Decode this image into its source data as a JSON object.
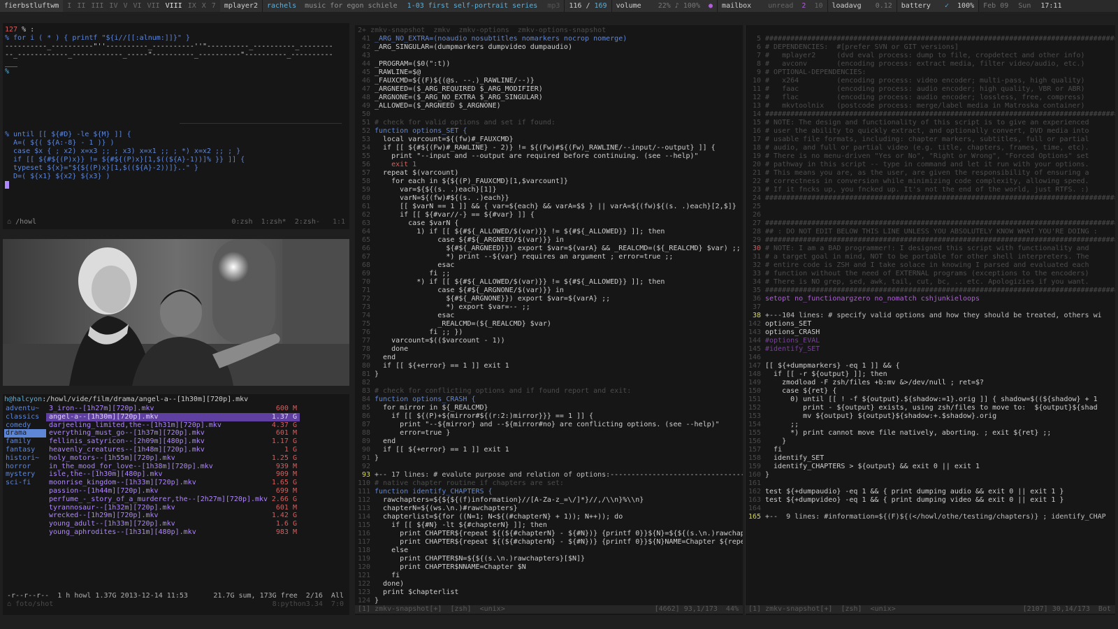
{
  "topbar": {
    "wm_name": "fierbstluftwm",
    "tags": [
      "I",
      "II",
      "III",
      "IV",
      "V",
      "VI",
      "VII",
      "VIII",
      "IX",
      "X"
    ],
    "tag_extra": "7",
    "player": "mplayer2",
    "artist": "rachels",
    "album": "music for egon schiele",
    "track": "1-03 first self-portrait series",
    "format": "mp3",
    "pos": "116",
    "total": "169",
    "volume_label": "volume",
    "volume_value": "22%",
    "volume_max": "100%",
    "mailbox_label": "mailbox",
    "unread_label": "unread",
    "unread": "2",
    "mail_total": "10",
    "loadavg_label": "loadavg",
    "loadavg": "0.12",
    "battery_label": "battery",
    "battery_check": "✓",
    "battery": "100%",
    "date": "Feb 09",
    "day": "Sun",
    "time": "17:11"
  },
  "term1": {
    "prompt_num": "127",
    "line1": "% for i ( * ) { printf \"${i//[[:alnum:]]}\" }",
    "output1": "----------_----------\"''----------_----------''\"----------_----------_--------",
    "output2": "--_------------_------------_-----\"----------_----------\"----------_----------",
    "output3": "___ ",
    "prompt2": "%",
    "code": [
      "% until [[ ${#D} -le ${M} ]] {",
      "  A=( ${( ${A:-8} - 1 )} )",
      "  case $x { ; x2) x=x3 ;; ; x3) x=x1 ;; ; *) x=x2 ;; ; }",
      "  if [[ ${#${(P)x}} != ${#${(P)x}[1,$((${A}-1))]% }} ]] {",
      "  typeset ${x}=\"${${(P)x}[1,$((${A}-2))]}..\" }",
      "  D=( ${x1} ${x2} ${x3} )"
    ],
    "path": "/howl",
    "tabs": "0:zsh  1:zsh*  2:zsh-",
    "pos": "1:1"
  },
  "filemanager": {
    "path_host": "h@halcyon",
    "path": ":/howl/vide/film/drama/angel-a--[1h30m][720p].mkv",
    "categories": [
      "adventu~",
      "classics",
      "comedy",
      "drama",
      "family",
      "fantasy",
      "histori~",
      "horror",
      "mystery",
      "sci-fi"
    ],
    "selected_category": 3,
    "files": [
      {
        "name": "3_iron--[1h27m][720p].mkv",
        "size": "600 M"
      },
      {
        "name": "angel-a--[1h30m][720p].mkv",
        "size": "1.37 G"
      },
      {
        "name": "darjeeling_limited,the--[1h31m][720p].mkv",
        "size": "4.37 G"
      },
      {
        "name": "everything_must_go--[1h37m][720p].mkv",
        "size": "601 M"
      },
      {
        "name": "fellinis_satyricon--[2h09m][480p].mkv",
        "size": "1.17 G"
      },
      {
        "name": "heavenly_creatures--[1h48m][720p].mkv",
        "size": "1 G"
      },
      {
        "name": "holy_motors--[1h55m][720p].mkv",
        "size": "1.25 G"
      },
      {
        "name": "in_the_mood_for_love--[1h38m][720p].mkv",
        "size": "939 M"
      },
      {
        "name": "isle,the--[1h30m][480p].mkv",
        "size": "909 M"
      },
      {
        "name": "moonrise_kingdom--[1h33m][720p].mkv",
        "size": "1.65 G"
      },
      {
        "name": "passion--[1h44m][720p].mkv",
        "size": "699 M"
      },
      {
        "name": "perfume_-_story_of_a_murderer,the--[2h27m][720p].mkv",
        "size": "2.66 G"
      },
      {
        "name": "tyrannosaur--[1h32m][720p].mkv",
        "size": "601 M"
      },
      {
        "name": "wrecked--[1h29m][720p].mkv",
        "size": "1.42 G"
      },
      {
        "name": "young_adult--[1h33m][720p].mkv",
        "size": "1.6 G"
      },
      {
        "name": "young_aphrodites--[1h31m][480p].mkv",
        "size": "983 M"
      }
    ],
    "selected_file": 1,
    "status_left": "-r--r--r--  1 h howl 1.37G 2013-12-14 11:53",
    "status_right": "21.7G sum, 173G free  2/16  All",
    "footer_path": "foto/shot",
    "footer_right": "8:python3.34  7:0"
  },
  "editor_left": {
    "tabline": "2+ zmkv-snapshot  zmkv  zmkv-options  zmkv-options-snapshot",
    "lines": [
      [
        "41",
        "_ARG_NO_EXTRA=(noaudio nosubtitles nomarkers nocrop nomerge)",
        "kw"
      ],
      [
        "42",
        "_ARG_SINGULAR=(dumpmarkers dumpvideo dumpaudio)",
        "wh"
      ],
      [
        "43",
        "",
        ""
      ],
      [
        "44",
        "_PROGRAM=($0(\":t))",
        "wh"
      ],
      [
        "45",
        "_RAWLINE=$@",
        "wh"
      ],
      [
        "46",
        "_FAUXCMD=${(F)${(@s. --.)_RAWLINE/--)}",
        "wh"
      ],
      [
        "47",
        "_ARGNEED=($_ARG_REQUIRED $_ARG_MODIFIER)",
        "wh"
      ],
      [
        "48",
        "_ARGNONE=($_ARG_NO_EXTRA $_ARG_SINGULAR)",
        "wh"
      ],
      [
        "49",
        "_ALLOWED=($_ARGNEED $_ARGNONE)",
        "wh"
      ],
      [
        "50",
        "",
        ""
      ],
      [
        "51",
        "# check for valid options and set if found:",
        "cm"
      ],
      [
        "52",
        "function options_SET {",
        "kw"
      ],
      [
        "53",
        "  local varcount=${(fw)#_FAUXCMD}",
        "wh"
      ],
      [
        "54",
        "  if [[ ${#${(Fw)#_RAWLINE} - 2)} != ${(Fw)#${(Fw)_RAWLINE/--input/--output} ]] {",
        "wh"
      ],
      [
        "55",
        "    print \"--input and --output are required before continuing. (see --help)\"",
        "wh"
      ],
      [
        "56",
        "    exit 1",
        "red"
      ],
      [
        "57",
        "  repeat $(varcount)",
        "wh"
      ],
      [
        "58",
        "    for each in ${${(P)_FAUXCMD}[1,$varcount]}",
        "wh"
      ],
      [
        "59",
        "      var=${${(s. .)each}[1]}",
        "wh"
      ],
      [
        "60",
        "      varN=${(fw)#${(s. .)each}}",
        "wh"
      ],
      [
        "61",
        "      [[ $varN == 1 ]] && { var=${each} && varA=$$ } || varA=${(fw)${(s. .)each}[2,$]}",
        "wh"
      ],
      [
        "62",
        "      if [[ ${#var//-} == ${#var} ]] {",
        "wh"
      ],
      [
        "63",
        "        case $varN {",
        "wh"
      ],
      [
        "64",
        "          1) if [[ ${#${_ALLOWED/$(var)}} != ${#${_ALLOWED}} ]]; then",
        "wh"
      ],
      [
        "65",
        "               case ${#${_ARGNEED/$(var)}} in",
        "wh"
      ],
      [
        "66",
        "                 ${#${_ARGNEED}}) export $var=${varA} && _REALCMD=(${_REALCMD} $var) ;;",
        "wh"
      ],
      [
        "67",
        "                 *) print --${var} requires an argument ; error=true ;;",
        "wh"
      ],
      [
        "68",
        "               esac",
        "wh"
      ],
      [
        "69",
        "             fi ;;",
        "wh"
      ],
      [
        "70",
        "          *) if [[ ${#${_ALLOWED/$(var)}} != ${#${_ALLOWED}} ]]; then",
        "wh"
      ],
      [
        "71",
        "               case ${#${_ARGNONE/$(var)}} in",
        "wh"
      ],
      [
        "72",
        "                 ${#${_ARGNONE}}) export $var=${varA} ;;",
        "wh"
      ],
      [
        "73",
        "                 *) export $var=-- ;;",
        "wh"
      ],
      [
        "74",
        "               esac",
        "wh"
      ],
      [
        "75",
        "               _REALCMD=(${_REALCMD} $var)",
        "wh"
      ],
      [
        "76",
        "             fi ;; })",
        "wh"
      ],
      [
        "77",
        "    varcount=$(($varcount - 1))",
        "wh"
      ],
      [
        "78",
        "    done",
        "wh"
      ],
      [
        "79",
        "  end",
        "wh"
      ],
      [
        "80",
        "  if [[ ${+error} == 1 ]] exit 1",
        "wh"
      ],
      [
        "81",
        "}",
        "wh"
      ],
      [
        "82",
        "",
        ""
      ],
      [
        "83",
        "# check for conflicting options and if found report and exit:",
        "cm"
      ],
      [
        "84",
        "function options_CRASH {",
        "kw"
      ],
      [
        "85",
        "  for mirror in ${_REALCMD}",
        "wh"
      ],
      [
        "86",
        "    if [[ ${(P)+${mirror#${(r:2:)mirror}}} == 1 ]] {",
        "wh"
      ],
      [
        "87",
        "      print \"--${mirror} and --${mirror#no} are conflicting options. (see --help)\"",
        "wh"
      ],
      [
        "88",
        "      error=true }",
        "wh"
      ],
      [
        "89",
        "  end",
        "wh"
      ],
      [
        "90",
        "  if [[ ${+error} == 1 ]] exit 1",
        "wh"
      ],
      [
        "91",
        "}",
        "wh"
      ],
      [
        "92",
        "",
        ""
      ],
      [
        "93",
        "+-- 17 lines: # evalute purpose and relation of options:---------------------------------------",
        "fold"
      ],
      [
        "110",
        "# native chapter routine if chapters are set:",
        "cm"
      ],
      [
        "111",
        "function identify_CHAPTERS {",
        "kw"
      ],
      [
        "112",
        "  rawchapters=${${${(f)information}//[A-Za-z_=\\/]*}//,/\\\\n}%\\\\n}",
        "wh"
      ],
      [
        "113",
        "  chapterN=${(ws.\\n.)#rawchapters}",
        "wh"
      ],
      [
        "114",
        "  chapterlist=${for ((N=1; N<${(#chapterN} + 1)); N++)); do",
        "wh"
      ],
      [
        "115",
        "    if [[ ${#N} -lt ${#chapterN} ]]; then",
        "wh"
      ],
      [
        "116",
        "      print CHAPTER${repeat ${(${#chapterN} - ${#N})} {printf 0}}${N}=${${(s.\\n.)rawchapter",
        "wh"
      ],
      [
        "117",
        "      print CHAPTER${repeat ${(${#chapterN} - ${#N})} {printf 0}}${N}NAME=Chapter ${repeat",
        "wh"
      ],
      [
        "118",
        "    else",
        "wh"
      ],
      [
        "119",
        "      print CHAPTER$N=${${(s.\\n.)rawchapters}[$N]}",
        "wh"
      ],
      [
        "120",
        "      print CHAPTER$NNAME=Chapter $N",
        "wh"
      ],
      [
        "121",
        "    fi",
        "wh"
      ],
      [
        "122",
        "  done)",
        "wh"
      ],
      [
        "123",
        "  print $chapterlist",
        "wh"
      ],
      [
        "124",
        "}",
        "wh"
      ]
    ],
    "status_left": "[1] zmkv-snapshot[+]  [zsh]  <unix>",
    "status_right": "[4662] 93,1/173  44%"
  },
  "editor_right": {
    "lines": [
      [
        "5",
        "#############################################################################################",
        "cm"
      ],
      [
        "6",
        "# DEPENDENCIES:  #[prefer SVN or GIT versions]                                                 #",
        "cm"
      ],
      [
        "7",
        "#   mplayer2     (dvd eval process: dump to file, cropdetect and other info)                   #",
        "cm"
      ],
      [
        "8",
        "#   avconv       (encoding process: extract media, filter video/audio, etc.)                   #",
        "cm"
      ],
      [
        "9",
        "# OPTIONAL-DEPENDENCIES:                                                                        #",
        "cm"
      ],
      [
        "10",
        "#   x264         (encoding process: video encoder; multi-pass, high quality)                   #",
        "cm"
      ],
      [
        "11",
        "#   faac         (encoding process: audio encoder; high quality, VBR or ABR)                   #",
        "cm"
      ],
      [
        "12",
        "#   flac         (encoding process: audio encoder; lossless, free, compress)                   #",
        "cm"
      ],
      [
        "13",
        "#   mkvtoolnix   (postcode process: merge/label media in Matroska container)                   #",
        "cm"
      ],
      [
        "14",
        "#############################################################################################",
        "cm"
      ],
      [
        "15",
        "# NOTE: The design and functionality of this script is to give an experienced                #",
        "cm"
      ],
      [
        "16",
        "# user the ability to quickly extract, and optionally convert, DVD media into                  #",
        "cm"
      ],
      [
        "17",
        "# usable file formats, including: chapter markers, subtitles, full or partial                 #",
        "cm"
      ],
      [
        "18",
        "# audio, and full or partial video (e.g. title, chapters, frames, time, etc).                 #",
        "cm"
      ],
      [
        "19",
        "# There is no menu-driven \"Yes or No\", \"Right or Wrong\", \"Forced Options\" set                 #",
        "cm"
      ],
      [
        "20",
        "# pathway in this script -- type in command and let it run with your options.                  #",
        "cm"
      ],
      [
        "21",
        "# This means you are, as the user, are given the responsibility of ensuring a                 #",
        "cm"
      ],
      [
        "22",
        "# correctness in conversion while minimizing code complexity, allowing speed.                #",
        "cm"
      ],
      [
        "23",
        "# If it fncks up, you fncked up. It's not the end of the world, just RTFS. :)               #",
        "cm"
      ],
      [
        "24",
        "#############################################################################################",
        "cm"
      ],
      [
        "25",
        "",
        ""
      ],
      [
        "26",
        "",
        ""
      ],
      [
        "27",
        "#############################################################################################",
        "cm"
      ],
      [
        "28",
        "## : DO NOT EDIT BELOW THIS LINE UNLESS YOU ABSOLUTELY KNOW WHAT YOU'RE DOING :               ",
        "cm"
      ],
      [
        "29",
        "#############################################################################################",
        "cm"
      ],
      [
        "30",
        "# NOTE: I am a BAD programmer!: I designed this script with functionality and             #",
        "cmr"
      ],
      [
        "31",
        "# a target goal in mind, NOT to be portable for other shell interpreters. The             #",
        "cm"
      ],
      [
        "32",
        "# entire code is ZSH and I take solace in knowing I parsed and evaluated each             #",
        "cm"
      ],
      [
        "33",
        "# function without the need of EXTERNAL programs (exceptions to the encoders)            #",
        "cm"
      ],
      [
        "34",
        "# There is NO grep, sed, awk, tail, cut, bc, .. etc. Apologizies if you want.              #",
        "cm"
      ],
      [
        "35",
        "#############################################################################################",
        "cm"
      ],
      [
        "36",
        "setopt no_functionargzero no_nomatch cshjunkieloops",
        "pk"
      ],
      [
        "37",
        "",
        ""
      ],
      [
        "38",
        "+---104 lines: # specify valid options and how they should be treated, others wi",
        "fold"
      ],
      [
        "142",
        "options_SET",
        "wh"
      ],
      [
        "143",
        "options_CRASH",
        "wh"
      ],
      [
        "144",
        "#options_EVAL",
        "cmp"
      ],
      [
        "145",
        "#identify_SET",
        "cmp"
      ],
      [
        "146",
        "",
        ""
      ],
      [
        "147",
        "[[ ${+dumpmarkers} -eq 1 ]] && {",
        "wh"
      ],
      [
        "148",
        "  if [[ -r ${output} ]]; then",
        "wh"
      ],
      [
        "149",
        "    zmodload -F zsh/files +b:mv &>/dev/null ; ret=$?",
        "wh"
      ],
      [
        "150",
        "    case ${ret} {",
        "wh"
      ],
      [
        "151",
        "      0) until [[ ! -f ${output}.${shadow:=1}.orig ]] { shadow=$((${shadow} + 1",
        "wh"
      ],
      [
        "152",
        "         print - ${output} exists, using zsh/files to move to:  ${output}${shad",
        "wh"
      ],
      [
        "153",
        "         mv ${output} ${output}${shadow:+.$shadow}.orig",
        "wh"
      ],
      [
        "154",
        "      ;;",
        "wh"
      ],
      [
        "155",
        "      *) print cannot move file natively, aborting. ; exit ${ret} ;;",
        "wh"
      ],
      [
        "156",
        "    }",
        "wh"
      ],
      [
        "157",
        "  fi",
        "wh"
      ],
      [
        "158",
        "  identify_SET",
        "wh"
      ],
      [
        "159",
        "  identify_CHAPTERS > ${output} && exit 0 || exit 1",
        "wh"
      ],
      [
        "160",
        "}",
        "wh"
      ],
      [
        "161",
        "",
        ""
      ],
      [
        "162",
        "test ${+dumpaudio} -eq 1 && { print dumping audio && exit 0 || exit 1 }",
        "wh"
      ],
      [
        "163",
        "test ${+dumpvideo} -eq 1 && { print dumping video && exit 0 || exit 1 }",
        "wh"
      ],
      [
        "164",
        "",
        ""
      ],
      [
        "165",
        "+--  9 lines: #information=${(F)${(</howl/othe/testing/chapters)} ; identify_CHAP",
        "fold"
      ]
    ],
    "status_left": "[1] zmkv-snapshot[+]  [zsh]  <unix>",
    "status_right": "[2107] 30,14/173  Bot"
  },
  "colors": {
    "bg": "#161616",
    "accent_blue": "#5f87d7",
    "accent_purple": "#af87ff"
  }
}
